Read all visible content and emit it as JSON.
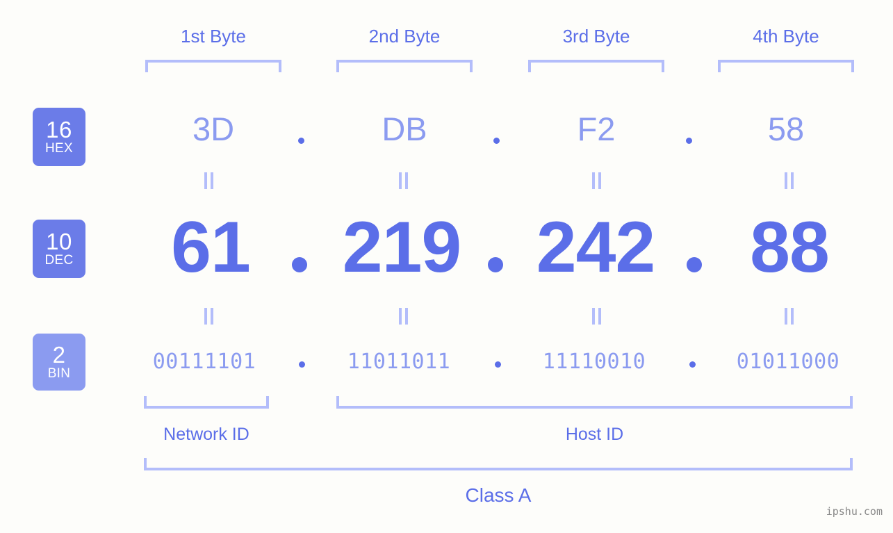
{
  "background_color": "#fdfdfa",
  "accent_color": "#5b6ee8",
  "accent_light_color": "#8b9bf0",
  "bracket_color": "#b3bdfa",
  "byte_headers": [
    {
      "label": "1st Byte"
    },
    {
      "label": "2nd Byte"
    },
    {
      "label": "3rd Byte"
    },
    {
      "label": "4th Byte"
    }
  ],
  "rows": {
    "hex": {
      "badge_number": "16",
      "badge_name": "HEX",
      "badge_color": "#6b7ce8",
      "values": [
        "3D",
        "DB",
        "F2",
        "58"
      ],
      "separator": "."
    },
    "dec": {
      "badge_number": "10",
      "badge_name": "DEC",
      "badge_color": "#6b7ce8",
      "values": [
        "61",
        "219",
        "242",
        "88"
      ],
      "separator": "."
    },
    "bin": {
      "badge_number": "2",
      "badge_name": "BIN",
      "badge_color": "#8b9bf0",
      "values": [
        "00111101",
        "11011011",
        "11110010",
        "01011000"
      ],
      "separator": "."
    }
  },
  "equals_marks": {
    "glyph": "=",
    "count_per_row": 4
  },
  "regions": {
    "network_id": {
      "label": "Network ID"
    },
    "host_id": {
      "label": "Host ID"
    },
    "ip_class": {
      "label": "Class A"
    }
  },
  "watermark": {
    "text": "ipshu.com"
  }
}
